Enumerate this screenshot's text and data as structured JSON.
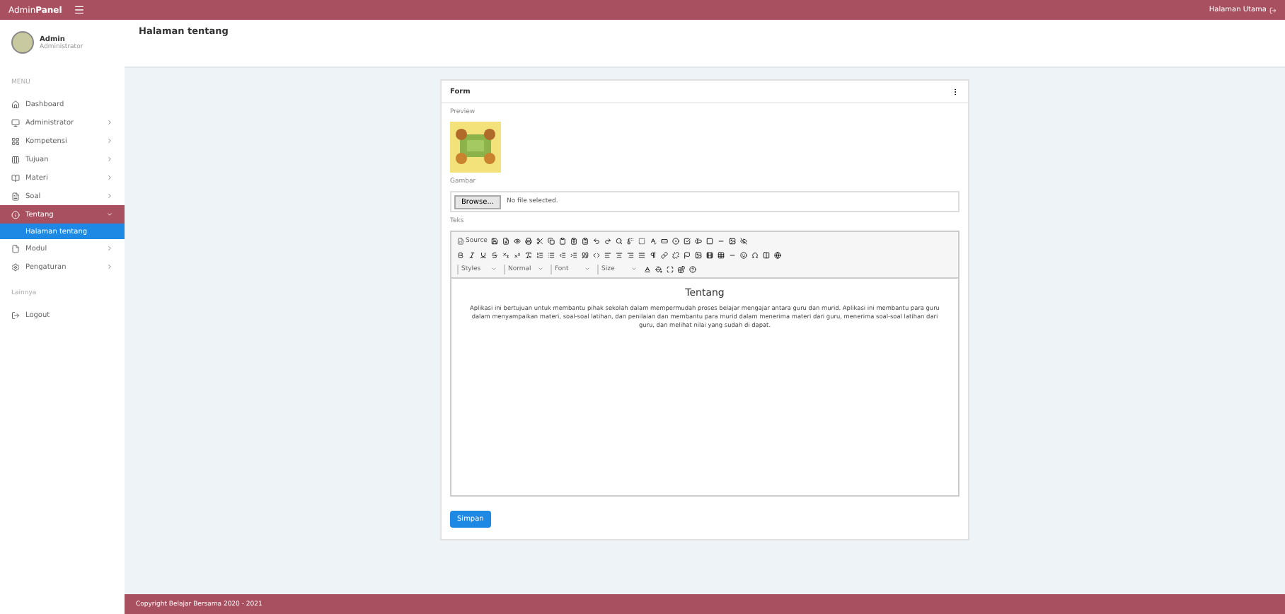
{
  "topbar": {
    "brand": "Admin**Panel**",
    "user": "Halaman Utama"
  },
  "sidebar": {
    "profile": {
      "name": "Admin",
      "role": "Administrator"
    },
    "sections": [
      {
        "title": "MENU",
        "items": [
          {
            "label": "Dashboard",
            "selected": false
          },
          {
            "label": "Administrator",
            "selected": false,
            "expanded": false
          },
          {
            "label": "Kompetensi",
            "selected": false,
            "expanded": false
          },
          {
            "label": "Tujuan",
            "selected": false,
            "expanded": false
          },
          {
            "label": "Materi",
            "selected": false,
            "expanded": false
          },
          {
            "label": "Soal",
            "selected": false,
            "expanded": false
          },
          {
            "label": "Tentang",
            "selected": true,
            "expanded": true,
            "children": [
              {
                "label": "Halaman tentang",
                "selected": true
              }
            ]
          },
          {
            "label": "Modul",
            "selected": false,
            "expanded": false
          },
          {
            "label": "Pengaturan",
            "selected": false,
            "expanded": false
          }
        ]
      },
      {
        "title": "Lainnya",
        "items": [
          {
            "label": "Logout",
            "selected": false
          }
        ]
      }
    ]
  },
  "page": {
    "title": "Halaman tentang"
  },
  "card": {
    "title": "Form",
    "preview_label": "Preview",
    "image_label": "Gambar",
    "file": {
      "button": "Browse...",
      "status": "No file selected."
    },
    "text_label": "Teks",
    "editor": {
      "source": "Source",
      "combos": [
        "Styles",
        "Normal",
        "Font",
        "Size"
      ],
      "heading": "Tentang",
      "paragraph": "Aplikasi ini bertujuan untuk membantu pihak sekolah dalam mempermudah proses belajar mengajar antara guru dan murid. Aplikasi ini membantu para guru dalam menyampaikan materi, soal-soal latihan, dan penilaian dan membantu para murid dalam menerima materi dari guru, menerima soal-soal latihan dari guru, dan melihat nilai yang sudah di dapat."
    },
    "save": "Simpan"
  },
  "footer": "Copyright Belajar Bersama 2020 - 2021"
}
